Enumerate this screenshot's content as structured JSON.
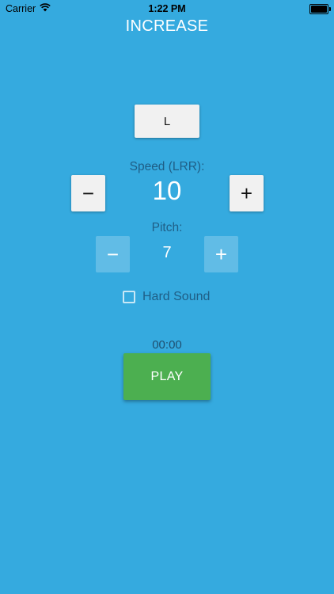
{
  "status_bar": {
    "carrier": "Carrier",
    "time": "1:22 PM",
    "icons": {
      "wifi": "wifi-icon",
      "battery": "battery-icon"
    }
  },
  "header": {
    "title": "INCREASE"
  },
  "mode_button": {
    "label": "L"
  },
  "speed": {
    "label": "Speed (LRR):",
    "value": "10",
    "minus": "−",
    "plus": "+"
  },
  "pitch": {
    "label": "Pitch:",
    "value": "7",
    "minus": "−",
    "plus": "+"
  },
  "hard_sound": {
    "label": "Hard Sound",
    "checked": false
  },
  "timer": {
    "value": "00:00"
  },
  "play_button": {
    "label": "PLAY"
  },
  "colors": {
    "background": "#35aadf",
    "play": "#4caf50",
    "button": "#f1f1f1",
    "label_text": "#1f5e86"
  }
}
